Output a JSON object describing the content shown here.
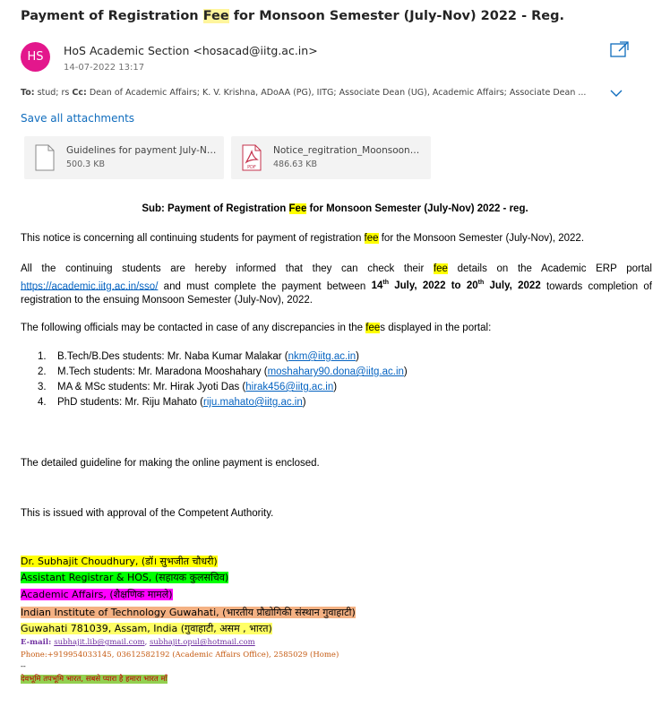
{
  "email": {
    "subject_pre": "Payment of Registration ",
    "subject_hl": "Fee",
    "subject_post": " for Monsoon Semester (July-Nov) 2022 - Reg.",
    "sender_initials": "HS",
    "sender": "HoS Academic Section <hosacad@iitg.ac.in>",
    "date": "14-07-2022 13:17",
    "to_label": "To:",
    "to_value": " stud; rs ",
    "cc_label": "Cc:",
    "cc_value": " Dean of Academic Affairs; K. V. Krishna, ADoAA (PG), IITG; Associate Dean (UG), Academic Affairs; Associate Dean ..."
  },
  "attachments": {
    "save_all": "Save all attachments",
    "items": [
      {
        "name": "Guidelines for payment July-No...",
        "size": "500.3 KB",
        "icon": "file-icon"
      },
      {
        "name": "Notice_regitration_Moonsoon20...",
        "size": "486.63 KB",
        "icon": "pdf-icon",
        "icon_label": "PDF"
      }
    ]
  },
  "body": {
    "sub_pre": "Sub: Payment of Registration ",
    "sub_hl": "Fee",
    "sub_post": " for Monsoon Semester (July-Nov) 2022 - reg.",
    "p1_pre": "This notice is concerning all continuing students for payment of registration ",
    "p1_hl": "fee",
    "p1_post": " for the Monsoon Semester (July-Nov), 2022.",
    "p2_pre": "All the continuing students are hereby informed that they can check their ",
    "p2_hl": "fee",
    "p2_mid": " details on the Academic ERP portal ",
    "p2_link": "https://academic.iitg.ac.in/sso/",
    "p2_a": " and must complete the payment between ",
    "p2_d1": "14",
    "p2_d1sup": "th",
    "p2_d2": " July, 2022 to 20",
    "p2_d2sup": "th",
    "p2_d3": " July, 2022",
    "p2_post": " towards completion of registration to the ensuing Monsoon Semester (July-Nov), 2022.",
    "p3_pre": "The following officials may be contacted in case of any discrepancies in the ",
    "p3_hl": "fee",
    "p3_post": "s displayed in the portal:",
    "contacts": [
      {
        "num": "1.",
        "text": "B.Tech/B.Des students: Mr. Naba Kumar Malakar (",
        "email": "nkm@iitg.ac.in",
        "close": ")"
      },
      {
        "num": "2.",
        "text": "M.Tech students: Mr. Maradona Mooshahary (",
        "email": "moshahary90.dona@iitg.ac.in",
        "close": ")"
      },
      {
        "num": "3.",
        "text": "MA & MSc students: Mr. Hirak Jyoti Das (",
        "email": "hirak456@iitg.ac.in",
        "close": ")"
      },
      {
        "num": "4.",
        "text": "PhD students: Mr. Riju Mahato (",
        "email": "riju.mahato@iitg.ac.in",
        "close": ")"
      }
    ],
    "p4": "The detailed guideline for making the online payment is enclosed.",
    "p5": "This is issued with approval of the Competent Authority."
  },
  "signature": {
    "name": "Dr. Subhajit Choudhury, (डॉ। सुभजीत चौधरी)",
    "role": "Assistant Registrar & HOS, (सहायक कुलसचिव)",
    "dept": "Academic Affairs, (शैक्षणिक मामले)",
    "inst": "Indian Institute of Technology Guwahati, (भारतीय प्रौद्योगिकी संस्थान गुवाहाटी)",
    "addr": "Guwahati 781039, Assam, India (गुवाहाटी, असम , भारत)",
    "email_label": "E-mail: ",
    "email1": "subhajit.lib@gmail.com",
    "email_sep": ", ",
    "email2": "subhajit.opul@hotmail.com",
    "phone": "Phone:+919954033145, 03612582192 (Academic Affairs Office), 2585029 (Home)",
    "dashes": "--",
    "motto": "देवभूमि तपभूमि भारत, सबसे प्यारा है हमारा भारत माँ"
  },
  "colors": {
    "avatar": "#e3178c",
    "link": "#0f6cbd",
    "hl_search": "#fff59d",
    "sig_name": "#ffff00",
    "sig_role": "#00ff00",
    "sig_dept": "#ff00ff",
    "sig_inst": "#f4b183",
    "sig_addr": "#ffff66",
    "sig_motto": "#92d050"
  },
  "icons": {
    "popout": "popout-icon",
    "expand": "chevron-down-icon"
  }
}
